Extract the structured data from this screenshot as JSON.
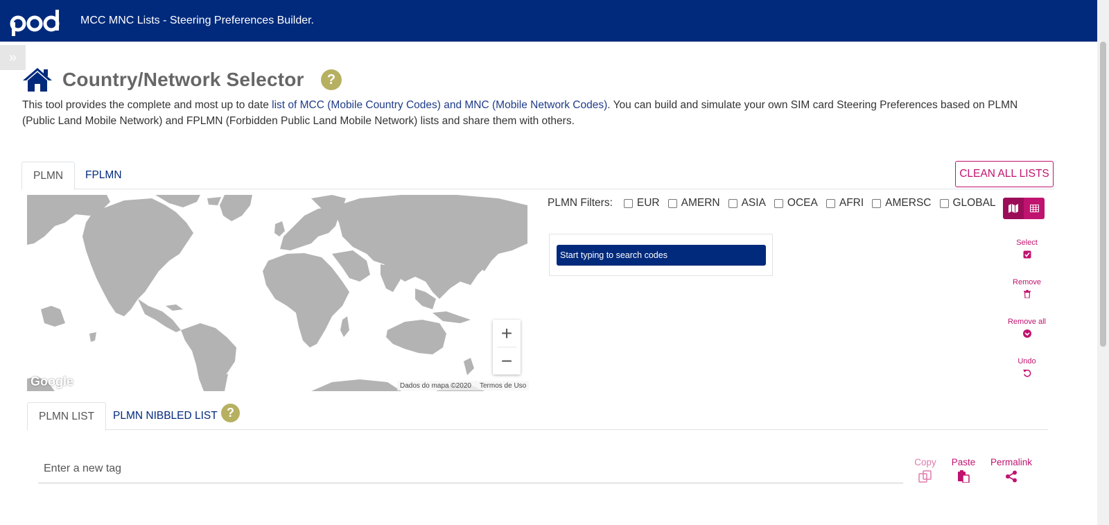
{
  "header": {
    "logo_text": "pod",
    "app_title": "MCC MNC Lists - Steering Preferences Builder."
  },
  "sidebar": {
    "toggle_glyph": "»"
  },
  "page": {
    "title": "Country/Network Selector",
    "help_glyph": "?",
    "intro_before_link": "This tool provides the complete and most up to date ",
    "intro_link": "list of MCC (Mobile Country Codes) and MNC (Mobile Network Codes)",
    "intro_after_link": ". You can build and simulate your own SIM card Steering Preferences based on PLMN (Public Land Mobile Network) and FPLMN (Forbidden Public Land Mobile Network) lists and share them with others."
  },
  "tabs_top": {
    "plmn": "PLMN",
    "fplmn": "FPLMN",
    "clean_all": "CLEAN ALL LISTS"
  },
  "map": {
    "google_label": "Google",
    "attribution": "Dados do mapa ©2020",
    "terms": "Termos de Uso",
    "zoom_in": "+",
    "zoom_out": "−"
  },
  "filters": {
    "label": "PLMN Filters:",
    "options": [
      {
        "label": "EUR",
        "checked": false
      },
      {
        "label": "AMERN",
        "checked": false
      },
      {
        "label": "ASIA",
        "checked": false
      },
      {
        "label": "OCEA",
        "checked": false
      },
      {
        "label": "AFRI",
        "checked": false
      },
      {
        "label": "AMERSC",
        "checked": false
      },
      {
        "label": "GLOBAL",
        "checked": false
      }
    ]
  },
  "search": {
    "placeholder": "Start typing to search codes"
  },
  "actions": {
    "select": "Select",
    "remove": "Remove",
    "remove_all": "Remove all",
    "undo": "Undo"
  },
  "tabs_bottom": {
    "plmn_list": "PLMN LIST",
    "plmn_nibbled": "PLMN NIBBLED LIST",
    "help_glyph": "?"
  },
  "tag_input": {
    "placeholder": "Enter a new tag"
  },
  "tools": {
    "copy": "Copy",
    "paste": "Paste",
    "permalink": "Permalink"
  },
  "colors": {
    "brand_navy": "#022a7c",
    "accent_magenta": "#c0136f",
    "help_olive": "#b6b061",
    "map_land": "#b3b3b3"
  }
}
